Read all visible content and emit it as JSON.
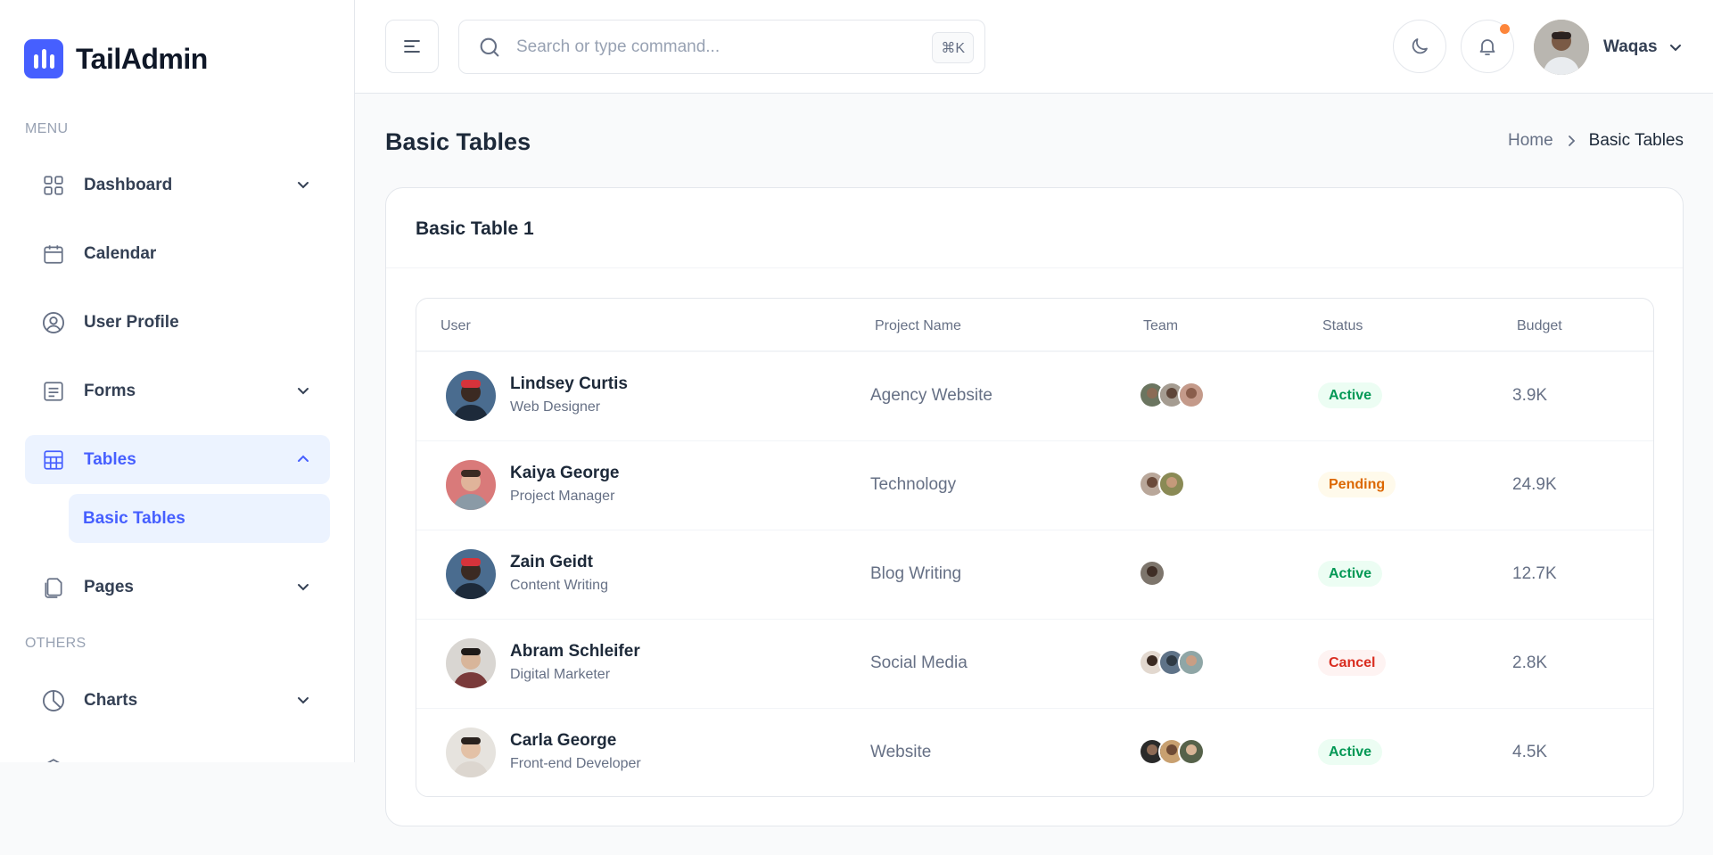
{
  "app": {
    "name": "TailAdmin"
  },
  "sidebar": {
    "menu_heading": "MENU",
    "others_heading": "OTHERS",
    "items": [
      {
        "label": "Dashboard",
        "icon": "grid-icon"
      },
      {
        "label": "Calendar",
        "icon": "calendar-icon"
      },
      {
        "label": "User Profile",
        "icon": "user-circle-icon"
      },
      {
        "label": "Forms",
        "icon": "form-icon"
      },
      {
        "label": "Tables",
        "icon": "table-icon"
      },
      {
        "label": "Pages",
        "icon": "pages-icon"
      }
    ],
    "submenu": {
      "label": "Basic Tables"
    },
    "others": [
      {
        "label": "Charts",
        "icon": "pie-chart-icon"
      }
    ]
  },
  "header": {
    "search_placeholder": "Search or type command...",
    "shortcut": "⌘K",
    "user_name": "Waqas"
  },
  "page": {
    "title": "Basic Tables",
    "breadcrumb": {
      "home": "Home",
      "current": "Basic Tables"
    }
  },
  "card": {
    "title": "Basic Table 1",
    "columns": [
      "User",
      "Project Name",
      "Team",
      "Status",
      "Budget"
    ],
    "rows": [
      {
        "name": "Lindsey Curtis",
        "role": "Web Designer",
        "project": "Agency Website",
        "team_size": 3,
        "status": "Active",
        "budget": "3.9K"
      },
      {
        "name": "Kaiya George",
        "role": "Project Manager",
        "project": "Technology",
        "team_size": 2,
        "status": "Pending",
        "budget": "24.9K"
      },
      {
        "name": "Zain Geidt",
        "role": "Content Writing",
        "project": "Blog Writing",
        "team_size": 1,
        "status": "Active",
        "budget": "12.7K"
      },
      {
        "name": "Abram Schleifer",
        "role": "Digital Marketer",
        "project": "Social Media",
        "team_size": 3,
        "status": "Cancel",
        "budget": "2.8K"
      },
      {
        "name": "Carla George",
        "role": "Front-end Developer",
        "project": "Website",
        "team_size": 3,
        "status": "Active",
        "budget": "4.5K"
      }
    ]
  },
  "colors": {
    "brand": "#465fff",
    "active": "#039855",
    "pending": "#dc6803",
    "cancel": "#d92d20",
    "notification_dot": "#fd853a"
  }
}
